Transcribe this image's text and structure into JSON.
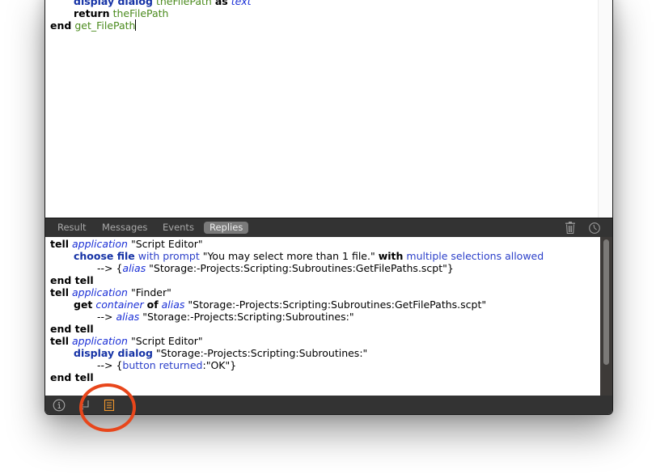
{
  "editor": {
    "lines": [
      {
        "indent": 1,
        "tokens": [
          {
            "t": "display dialog",
            "c": "cmd"
          },
          {
            "t": " ",
            "c": "str"
          },
          {
            "t": "theFilePath",
            "c": "var"
          },
          {
            "t": " ",
            "c": "str"
          },
          {
            "t": "as",
            "c": "kw"
          },
          {
            "t": " ",
            "c": "str"
          },
          {
            "t": "text",
            "c": "cls"
          }
        ]
      },
      {
        "indent": 1,
        "tokens": [
          {
            "t": "return",
            "c": "kw"
          },
          {
            "t": " ",
            "c": "str"
          },
          {
            "t": "theFilePath",
            "c": "var"
          }
        ]
      },
      {
        "indent": 0,
        "tokens": [
          {
            "t": "end",
            "c": "kw"
          },
          {
            "t": " ",
            "c": "str"
          },
          {
            "t": "get_FilePath",
            "c": "var"
          }
        ],
        "caret": true
      }
    ]
  },
  "tabs": {
    "items": [
      {
        "label": "Result",
        "active": false
      },
      {
        "label": "Messages",
        "active": false
      },
      {
        "label": "Events",
        "active": false
      },
      {
        "label": "Replies",
        "active": true
      }
    ],
    "trash_icon": "trash-icon",
    "history_icon": "clock-icon"
  },
  "log": {
    "lines": [
      {
        "indent": 0,
        "tokens": [
          {
            "t": "tell",
            "c": "kw"
          },
          {
            "t": " ",
            "c": "str"
          },
          {
            "t": "application",
            "c": "cls"
          },
          {
            "t": " \"Script Editor\"",
            "c": "str"
          }
        ]
      },
      {
        "indent": 1,
        "tokens": [
          {
            "t": "choose file",
            "c": "cmd"
          },
          {
            "t": " ",
            "c": "str"
          },
          {
            "t": "with prompt",
            "c": "prm"
          },
          {
            "t": " \"You may select more than 1 file.\" ",
            "c": "str"
          },
          {
            "t": "with",
            "c": "kw"
          },
          {
            "t": " ",
            "c": "str"
          },
          {
            "t": "multiple selections allowed",
            "c": "prm"
          }
        ]
      },
      {
        "indent": 2,
        "tokens": [
          {
            "t": "--> {",
            "c": "str"
          },
          {
            "t": "alias",
            "c": "cls"
          },
          {
            "t": " \"Storage:-Projects:Scripting:Subroutines:GetFilePaths.scpt\"}",
            "c": "str"
          }
        ]
      },
      {
        "indent": 0,
        "tokens": [
          {
            "t": "end tell",
            "c": "kw"
          }
        ]
      },
      {
        "indent": 0,
        "tokens": [
          {
            "t": "tell",
            "c": "kw"
          },
          {
            "t": " ",
            "c": "str"
          },
          {
            "t": "application",
            "c": "cls"
          },
          {
            "t": " \"Finder\"",
            "c": "str"
          }
        ]
      },
      {
        "indent": 1,
        "tokens": [
          {
            "t": "get",
            "c": "kw"
          },
          {
            "t": " ",
            "c": "str"
          },
          {
            "t": "container",
            "c": "cls"
          },
          {
            "t": " ",
            "c": "str"
          },
          {
            "t": "of",
            "c": "kw"
          },
          {
            "t": " ",
            "c": "str"
          },
          {
            "t": "alias",
            "c": "cls"
          },
          {
            "t": " \"Storage:-Projects:Scripting:Subroutines:GetFilePaths.scpt\"",
            "c": "str"
          }
        ]
      },
      {
        "indent": 2,
        "tokens": [
          {
            "t": "--> ",
            "c": "str"
          },
          {
            "t": "alias",
            "c": "cls"
          },
          {
            "t": " \"Storage:-Projects:Scripting:Subroutines:\"",
            "c": "str"
          }
        ]
      },
      {
        "indent": 0,
        "tokens": [
          {
            "t": "end tell",
            "c": "kw"
          }
        ]
      },
      {
        "indent": 0,
        "tokens": [
          {
            "t": "tell",
            "c": "kw"
          },
          {
            "t": " ",
            "c": "str"
          },
          {
            "t": "application",
            "c": "cls"
          },
          {
            "t": " \"Script Editor\"",
            "c": "str"
          }
        ]
      },
      {
        "indent": 1,
        "tokens": [
          {
            "t": "display dialog",
            "c": "cmd"
          },
          {
            "t": " \"Storage:-Projects:Scripting:Subroutines:\"",
            "c": "str"
          }
        ]
      },
      {
        "indent": 2,
        "tokens": [
          {
            "t": "--> {",
            "c": "str"
          },
          {
            "t": "button returned",
            "c": "prm"
          },
          {
            "t": ":\"OK\"}",
            "c": "str"
          }
        ]
      },
      {
        "indent": 0,
        "tokens": [
          {
            "t": "end tell",
            "c": "kw"
          }
        ]
      }
    ]
  },
  "bottombar": {
    "info_icon": "info-icon",
    "return_icon": "return-arrow-icon",
    "log_icon": "document-list-icon"
  },
  "colors": {
    "keyword": "#000000",
    "command": "#1633a6",
    "variable": "#4a8a1c",
    "class": "#1a2fd6",
    "parameter": "#2b3fc9",
    "bar_background": "#333333",
    "active_tab": "#7a7a7a",
    "highlight_icon": "#f0962e",
    "annotation": "#e8461b"
  }
}
